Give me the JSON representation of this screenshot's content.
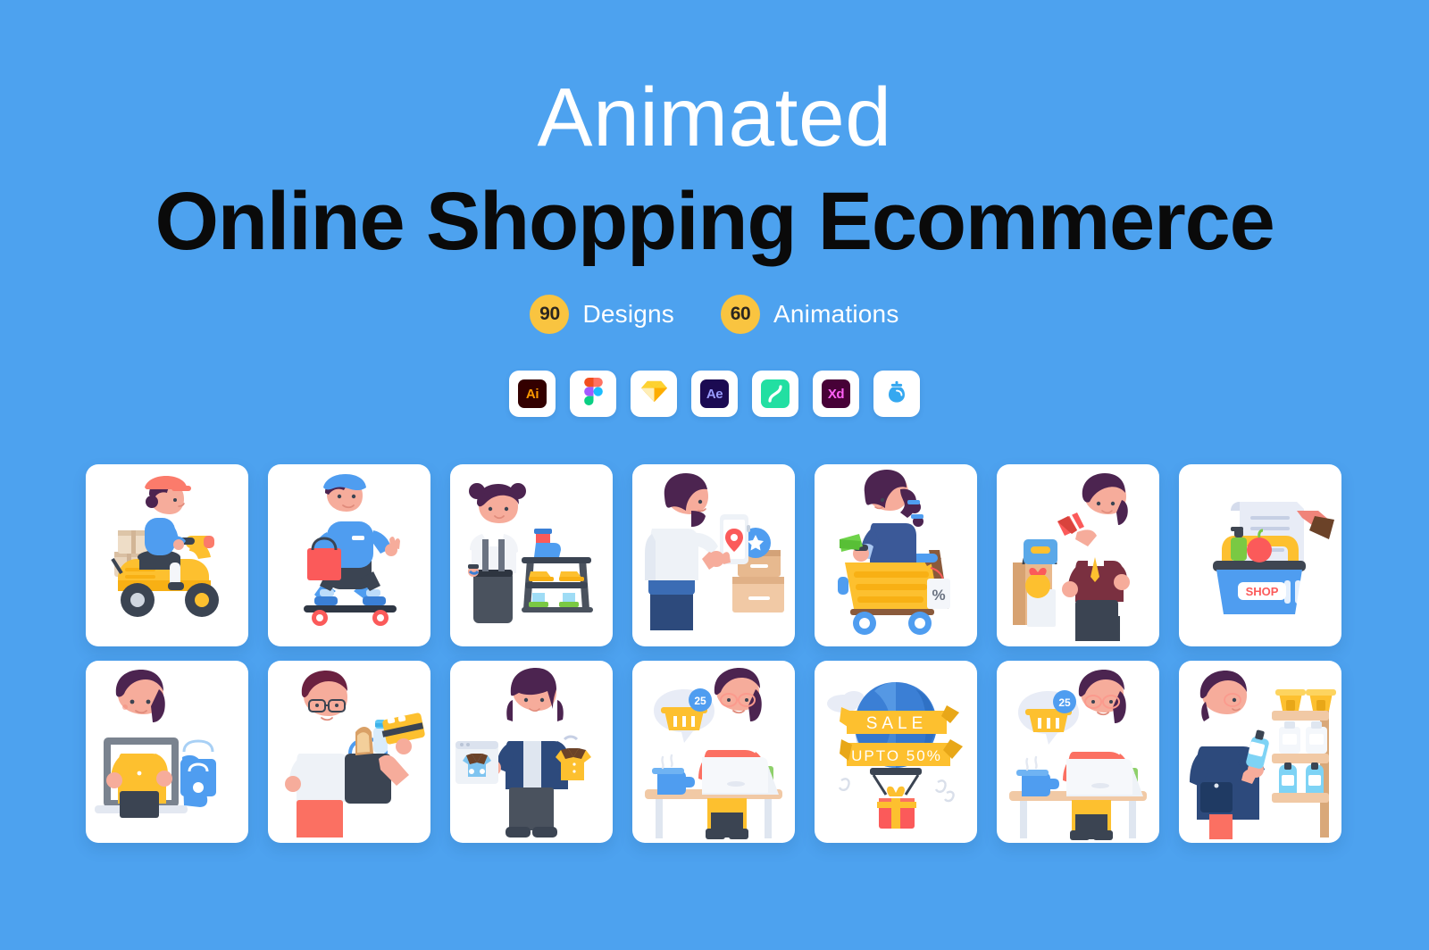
{
  "background_color": "#4da2ef",
  "header": {
    "eyebrow_title": "Animated",
    "main_title": "Online Shopping Ecommerce"
  },
  "counts": [
    {
      "value": "90",
      "label": "Designs"
    },
    {
      "value": "60",
      "label": "Animations"
    }
  ],
  "tools": [
    {
      "name": "adobe-illustrator",
      "glyph": "Ai",
      "color": "#330000",
      "text_color": "#ff9a00"
    },
    {
      "name": "figma",
      "glyph": "",
      "color": "#ffffff",
      "text_color": "#f24e1e"
    },
    {
      "name": "sketch",
      "glyph": "",
      "color": "#ffffff",
      "text_color": "#fdad00"
    },
    {
      "name": "adobe-after-effects",
      "glyph": "Ae",
      "color": "#1b0a52",
      "text_color": "#9a9cff"
    },
    {
      "name": "principle",
      "glyph": "",
      "color": "#22dfa2",
      "text_color": "#ffffff"
    },
    {
      "name": "adobe-xd",
      "glyph": "Xd",
      "color": "#470137",
      "text_color": "#ff61f6"
    },
    {
      "name": "lottie",
      "glyph": "",
      "color": "#ffffff",
      "text_color": "#35a8f0"
    }
  ],
  "accent_colors": {
    "badge_yellow": "#f9c440",
    "card_white": "#ffffff",
    "title_black": "#0a0a0a",
    "title_white": "#ffffff"
  },
  "cards": [
    {
      "id": "delivery-scooter",
      "title": "Delivery Scooter Rider"
    },
    {
      "id": "skateboard-delivery",
      "title": "Skateboard Shopping Bag"
    },
    {
      "id": "shoe-shop-rack",
      "title": "Girl At Shoe Rack"
    },
    {
      "id": "order-tracking-phone",
      "title": "Order Tracking On Phone"
    },
    {
      "id": "cart-discount-ride",
      "title": "Woman In Discount Cart"
    },
    {
      "id": "handbag-gift-shopper",
      "title": "Woman With Handbag And Gift"
    },
    {
      "id": "shopping-basket-receipt",
      "title": "Shopping Basket With Receipt"
    },
    {
      "id": "laptop-online-shopper",
      "title": "Online Shopping On Laptop"
    },
    {
      "id": "groceries-card-payment",
      "title": "Groceries And Card Payment"
    },
    {
      "id": "compare-clothes",
      "title": "Comparing Clothes Online"
    },
    {
      "id": "desk-cart-notification",
      "title": "Desk Shopper With Cart Badge"
    },
    {
      "id": "sale-hot-air-balloon",
      "title": "Sale Hot Air Balloon"
    },
    {
      "id": "desk-cart-notification-2",
      "title": "Desk Shopper With Cart Badge"
    },
    {
      "id": "store-shelf-browsing",
      "title": "Browsing Store Shelf"
    }
  ],
  "card_labels": {
    "basket_shop_text": "SHOP",
    "discount_tag_text": "%",
    "cart_badge_count": "25",
    "balloon_sale_text": "SALE",
    "balloon_offer_text": "UPTO 50%"
  }
}
